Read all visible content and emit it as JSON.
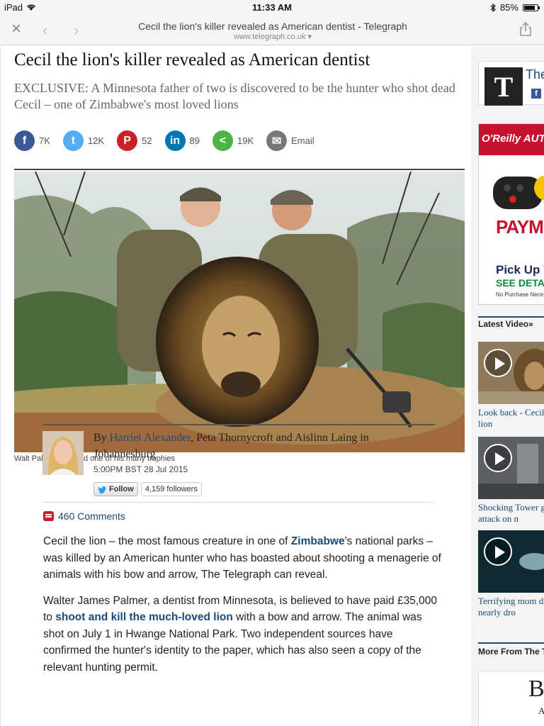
{
  "status_bar": {
    "device": "iPad",
    "time": "11:33 AM",
    "battery": "85%",
    "battery_level": 0.85
  },
  "browser": {
    "page_title": "Cecil the lion's killer revealed as American dentist - Telegraph",
    "url": "www.telegraph.co.uk ▾"
  },
  "article": {
    "headline": "Cecil the lion's killer revealed as American dentist",
    "standfirst": "EXCLUSIVE: A Minnesota father of two is discovered to be the hunter who shot dead Cecil – one of Zimbabwe's most loved lions",
    "shares": [
      {
        "network": "facebook",
        "icon": "f",
        "count": "7K",
        "color": "#3b5998"
      },
      {
        "network": "twitter",
        "icon": "t",
        "count": "12K",
        "color": "#55acee"
      },
      {
        "network": "pinterest",
        "icon": "P",
        "count": "52",
        "color": "#cb2027"
      },
      {
        "network": "linkedin",
        "icon": "in",
        "count": "89",
        "color": "#0077b5"
      },
      {
        "network": "share",
        "icon": "<",
        "count": "19K",
        "color": "#4bb543"
      },
      {
        "network": "email",
        "icon": "✉",
        "count": "Email",
        "color": "#777777"
      }
    ],
    "caption": "Walt Palmer, left, and one of his many trophies",
    "byline": {
      "by": "By ",
      "author_link": "Harriet Alexander",
      "rest": ", Peta Thornycroft and Aislinn Laing in Johannesburg",
      "date": "5:00PM BST 28 Jul 2015",
      "follow_label": "Follow",
      "followers": "4,159 followers"
    },
    "comments": "460 Comments",
    "paragraph_1": {
      "before": "Cecil the lion – the most famous creature in one of ",
      "link": "Zimbabwe",
      "after": "'s national parks – was killed by an American hunter who has boasted about shooting a menagerie of animals with his bow and arrow, The Telegraph can reveal."
    },
    "paragraph_2": {
      "before": "Walter James Palmer, a dentist from Minnesota, is believed to have paid £35,000 to ",
      "link": "shoot and kill the much-loved lion",
      "after": " with a bow and arrow. The animal was shot on July 1 in Hwange National Park. Two independent sources have confirmed the hunter's identity to the paper, which has also seen a copy of the relevant hunting permit."
    }
  },
  "sidebar": {
    "telegraph_title": "The",
    "telegraph_logo": "T",
    "facebook_mini": "f",
    "ad": {
      "brand": "O'Reilly AUTO",
      "pay": "PAYM",
      "pick": "Pick Up Y",
      "see": "SEE DETAIL",
      "fine": "No Purchase Nece"
    },
    "latest_video_heading": "Latest Video»",
    "videos": [
      {
        "caption": "Look back - Cecil the lion"
      },
      {
        "caption": "Shocking Tower gang attack on n"
      },
      {
        "caption": "Terrifying mom diver nearly dro"
      }
    ],
    "more_heading": "More From The T",
    "more_B": "B",
    "more_A": "A"
  }
}
